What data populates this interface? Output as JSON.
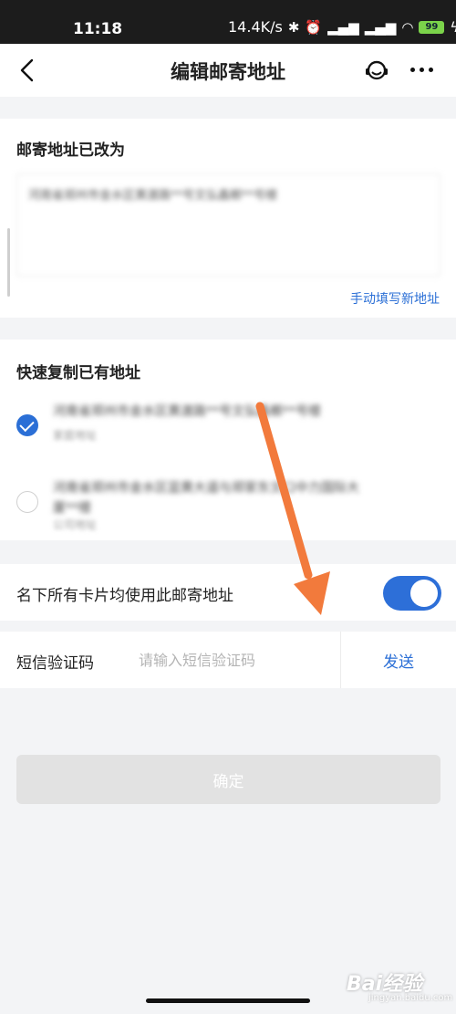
{
  "status_bar": {
    "time": "11:18",
    "net_speed": "14.4K/s",
    "battery": "99"
  },
  "header": {
    "title": "编辑邮寄地址",
    "back_icon": "chevron-left-icon",
    "service_icon": "headset-icon",
    "more_icon": "more-dots-icon"
  },
  "address_section": {
    "title": "邮寄地址已改为",
    "value": "河南省郑州市金水区黄渡路**号文弘鑫榔**号楼",
    "manual_link": "手动填写新地址"
  },
  "copy_section": {
    "title": "快速复制已有地址",
    "options": [
      {
        "address": "河南省郑州市金水区黄渡路**号文弘鑫榔**号楼",
        "label": "家庭地址",
        "selected": true
      },
      {
        "address": "河南省郑州市金水区蓝黄大道与郑家东文口中力国际大厦**楼",
        "label": "公司地址",
        "selected": false
      }
    ]
  },
  "toggle_row": {
    "label": "名下所有卡片均使用此邮寄地址",
    "enabled": true
  },
  "sms_row": {
    "label": "短信验证码",
    "placeholder": "请输入短信验证码",
    "value": "",
    "send_label": "发送"
  },
  "confirm_label": "确定",
  "watermark": {
    "text": "Bai经验",
    "subtext": "jingyan.baidu.com"
  },
  "colors": {
    "accent": "#2b6fd6",
    "toggle_on": "#2d6fd8",
    "arrow": "#f27a3c",
    "disabled_button": "#e2e2e2"
  }
}
